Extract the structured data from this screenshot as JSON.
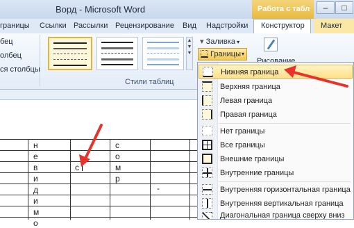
{
  "titlebar": {
    "title": "Ворд - Microsoft Word",
    "context_label": "Работа с табл",
    "controls": [
      "–",
      "□"
    ]
  },
  "tabs": [
    "границы",
    "Ссылки",
    "Рассылки",
    "Рецензирование",
    "Вид",
    "Надстройки",
    "Конструктор",
    "Макет"
  ],
  "ribbon": {
    "left_options": [
      "бец",
      "олбец",
      "ся столбцы"
    ],
    "styles_group_label": "Стили таблиц",
    "shading_label": "Заливка",
    "borders_label": "Границы",
    "draw_label": "Рисование"
  },
  "table": {
    "rows": [
      [
        "",
        "н",
        "",
        "с",
        ""
      ],
      [
        "",
        "е",
        "",
        "о",
        ""
      ],
      [
        "",
        "в",
        "с",
        "м",
        ""
      ],
      [
        "",
        "и",
        "",
        "р",
        ""
      ],
      [
        "",
        "д",
        "",
        "",
        "-"
      ],
      [
        "",
        "и",
        "",
        "",
        ""
      ],
      [
        "",
        "м",
        "",
        "",
        ""
      ],
      [
        "",
        "о",
        "",
        "",
        ""
      ]
    ]
  },
  "borders_menu": {
    "items": [
      {
        "label": "Нижняя граница",
        "icon": "border-bottom-icon",
        "highlighted": true
      },
      {
        "label": "Верхняя граница",
        "icon": "border-top-icon"
      },
      {
        "label": "Левая граница",
        "icon": "border-left-icon"
      },
      {
        "label": "Правая граница",
        "icon": "border-right-icon"
      },
      {
        "label": "Нет границы",
        "icon": "border-none-icon"
      },
      {
        "label": "Все границы",
        "icon": "border-all-icon"
      },
      {
        "label": "Внешние границы",
        "icon": "border-outside-icon"
      },
      {
        "label": "Внутренние границы",
        "icon": "border-inside-icon"
      },
      {
        "label": "Внутренняя горизонтальная граница",
        "icon": "border-inside-horizontal-icon"
      },
      {
        "label": "Внутренняя вертикальная граница",
        "icon": "border-inside-vertical-icon"
      },
      {
        "label": "Диагональная граница сверху вниз",
        "icon": "border-diagonal-down-icon"
      }
    ]
  },
  "colors": {
    "accent_arrow": "#e8332a",
    "highlight": "#ffe08a"
  }
}
